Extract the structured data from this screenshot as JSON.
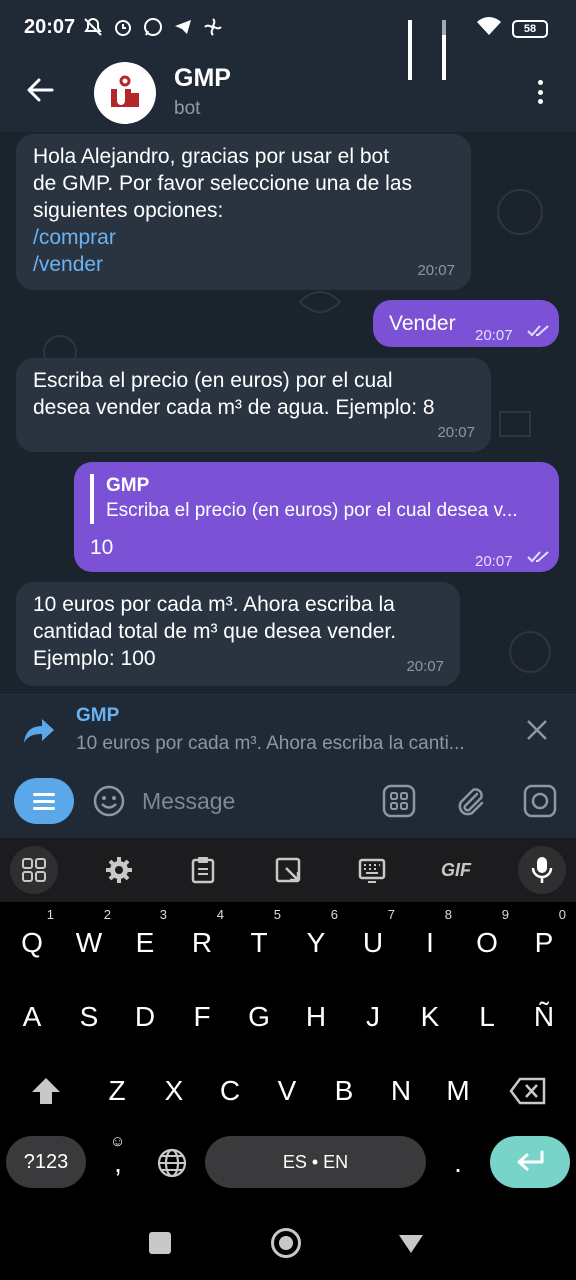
{
  "status_bar": {
    "time": "20:07",
    "battery": "58"
  },
  "header": {
    "title": "GMP",
    "subtitle": "bot"
  },
  "messages": [
    {
      "direction": "incoming",
      "lines": [
        "Hola Alejandro, gracias por usar el bot",
        "de GMP. Por favor seleccione una de las",
        "siguientes opciones:"
      ],
      "links": [
        "/comprar",
        "/vender"
      ],
      "time": "20:07"
    },
    {
      "direction": "outgoing",
      "text": "Vender",
      "time": "20:07"
    },
    {
      "direction": "incoming",
      "lines": [
        "Escriba el precio (en euros) por el cual",
        "desea vender cada m³ de agua. Ejemplo: 8"
      ],
      "time": "20:07"
    },
    {
      "direction": "outgoing",
      "reply_to_name": "GMP",
      "reply_to_text": "Escriba el precio (en euros) por el cual desea v...",
      "text": "10",
      "time": "20:07"
    },
    {
      "direction": "incoming",
      "lines": [
        "10 euros por cada m³. Ahora escriba la",
        "cantidad total de m³ que desea vender.",
        "Ejemplo: 100"
      ],
      "time": "20:07"
    }
  ],
  "reply_bar": {
    "name": "GMP",
    "text": "10 euros por cada m³. Ahora escriba la canti..."
  },
  "input_bar": {
    "placeholder": "Message"
  },
  "keyboard": {
    "tools": [
      "apps-icon",
      "settings-icon",
      "clipboard-icon",
      "resize-icon",
      "keyboard-icon",
      "GIF",
      "mic-icon"
    ],
    "gif_label": "GIF",
    "row1": [
      {
        "k": "Q",
        "n": "1"
      },
      {
        "k": "W",
        "n": "2"
      },
      {
        "k": "E",
        "n": "3"
      },
      {
        "k": "R",
        "n": "4"
      },
      {
        "k": "T",
        "n": "5"
      },
      {
        "k": "Y",
        "n": "6"
      },
      {
        "k": "U",
        "n": "7"
      },
      {
        "k": "I",
        "n": "8"
      },
      {
        "k": "O",
        "n": "9"
      },
      {
        "k": "P",
        "n": "0"
      }
    ],
    "row2": [
      "A",
      "S",
      "D",
      "F",
      "G",
      "H",
      "J",
      "K",
      "L",
      "Ñ"
    ],
    "row3": [
      "Z",
      "X",
      "C",
      "V",
      "B",
      "N",
      "M"
    ],
    "symbols_label": "?123",
    "comma_label": ",",
    "space_label": "ES • EN",
    "period_label": "."
  },
  "colors": {
    "header_bg": "#1f2a36",
    "chat_bg": "#1b232d",
    "incoming_bubble": "#2a3441",
    "outgoing_bubble": "#7b52d6",
    "link": "#6ab3f3",
    "enter_key": "#78d3c8"
  }
}
